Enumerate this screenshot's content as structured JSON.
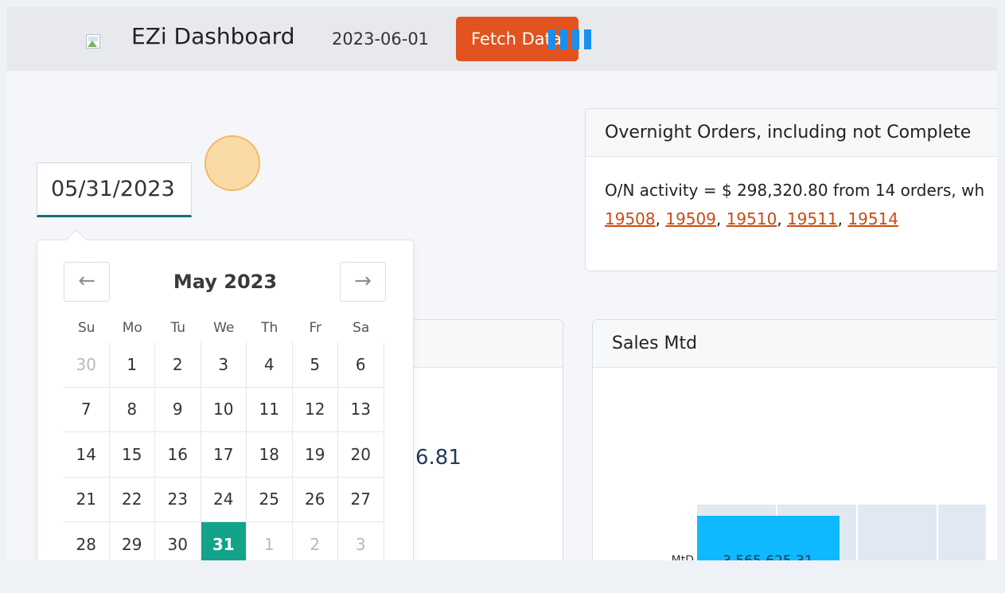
{
  "header": {
    "brand": "EZi Dashboard",
    "date": "2023-06-01",
    "fetch_label": "Fetch Data"
  },
  "date_input": {
    "value": "05/31/2023"
  },
  "calendar": {
    "month_title": "May 2023",
    "prev_glyph": "←",
    "next_glyph": "→",
    "weekdays": [
      "Su",
      "Mo",
      "Tu",
      "We",
      "Th",
      "Fr",
      "Sa"
    ],
    "days": [
      {
        "label": "30",
        "state": "outside"
      },
      {
        "label": "1",
        "state": "normal"
      },
      {
        "label": "2",
        "state": "normal"
      },
      {
        "label": "3",
        "state": "normal"
      },
      {
        "label": "4",
        "state": "normal"
      },
      {
        "label": "5",
        "state": "normal"
      },
      {
        "label": "6",
        "state": "normal"
      },
      {
        "label": "7",
        "state": "normal"
      },
      {
        "label": "8",
        "state": "normal"
      },
      {
        "label": "9",
        "state": "normal"
      },
      {
        "label": "10",
        "state": "normal"
      },
      {
        "label": "11",
        "state": "normal"
      },
      {
        "label": "12",
        "state": "normal"
      },
      {
        "label": "13",
        "state": "normal"
      },
      {
        "label": "14",
        "state": "normal"
      },
      {
        "label": "15",
        "state": "normal"
      },
      {
        "label": "16",
        "state": "normal"
      },
      {
        "label": "17",
        "state": "normal"
      },
      {
        "label": "18",
        "state": "normal"
      },
      {
        "label": "19",
        "state": "normal"
      },
      {
        "label": "20",
        "state": "normal"
      },
      {
        "label": "21",
        "state": "normal"
      },
      {
        "label": "22",
        "state": "normal"
      },
      {
        "label": "23",
        "state": "normal"
      },
      {
        "label": "24",
        "state": "normal"
      },
      {
        "label": "25",
        "state": "normal"
      },
      {
        "label": "26",
        "state": "normal"
      },
      {
        "label": "27",
        "state": "normal"
      },
      {
        "label": "28",
        "state": "normal"
      },
      {
        "label": "29",
        "state": "normal"
      },
      {
        "label": "30",
        "state": "normal"
      },
      {
        "label": "31",
        "state": "selected"
      },
      {
        "label": "1",
        "state": "outside"
      },
      {
        "label": "2",
        "state": "outside"
      },
      {
        "label": "3",
        "state": "outside"
      }
    ]
  },
  "overnight": {
    "title": "Overnight Orders, including not Complete",
    "summary": "O/N activity = $ 298,320.80 from 14 orders, wh",
    "order_links": [
      "19508",
      "19509",
      "19510",
      "19511",
      "19514"
    ]
  },
  "partial_card": {
    "value": "6.81"
  },
  "sales_mtd": {
    "title": "Sales Mtd",
    "bar_label": "MtD",
    "bar_value": "3,565,625.31"
  },
  "colors": {
    "accent_orange": "#e2531f",
    "link": "#cc4a12",
    "selected_day": "#13a38b",
    "bar": "#0fb9ff",
    "spinner": "#1a8ff2"
  }
}
